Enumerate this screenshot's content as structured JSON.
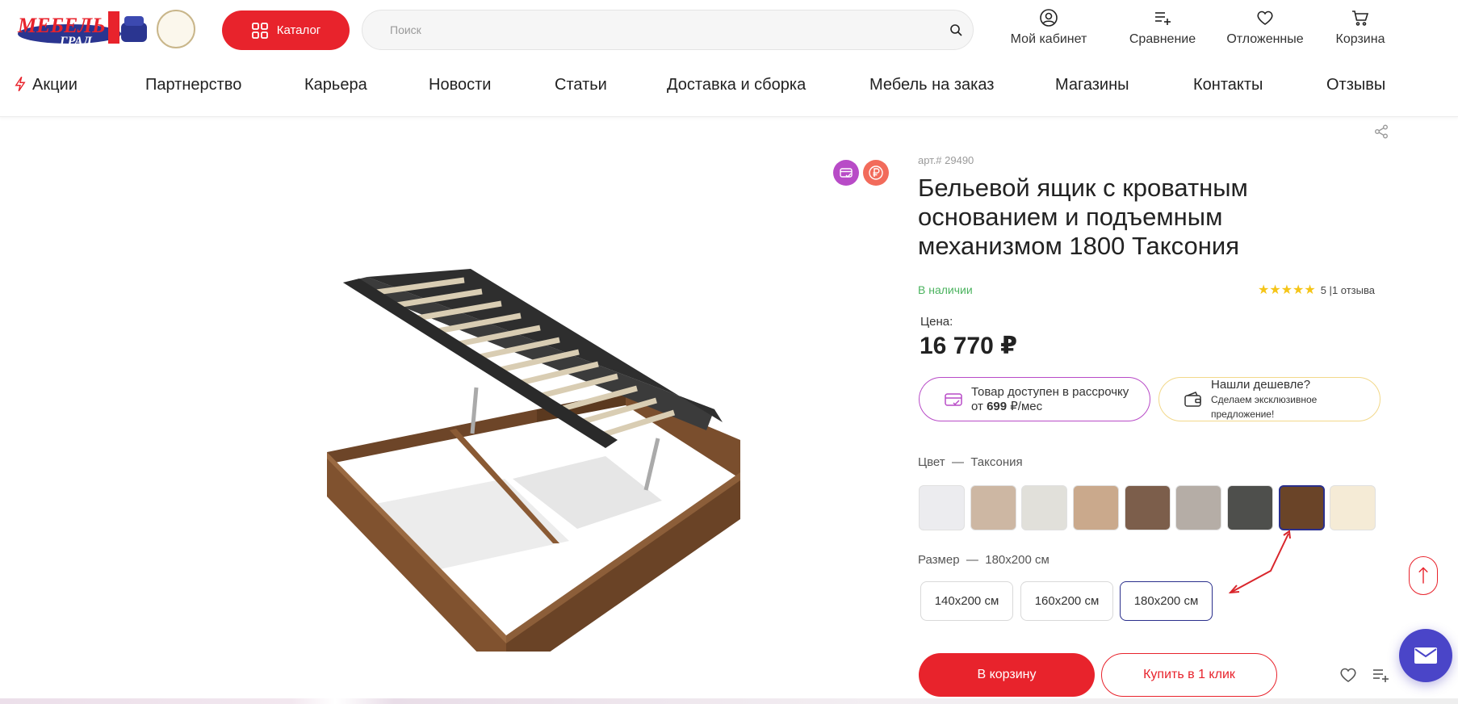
{
  "header": {
    "logo_text": "МЕБЕЛЬ ГРАД",
    "catalog_label": "Каталог",
    "search_placeholder": "Поиск",
    "account_label": "Мой кабинет",
    "compare_label": "Сравнение",
    "favorites_label": "Отложенные",
    "cart_label": "Корзина"
  },
  "nav": {
    "items": [
      "Акции",
      "Партнерство",
      "Карьера",
      "Новости",
      "Статьи",
      "Доставка и сборка",
      "Мебель на заказ",
      "Магазины",
      "Контакты",
      "Отзывы"
    ]
  },
  "product": {
    "sku": "арт.# 29490",
    "title": "Бельевой ящик с кроватным основанием и подъемным механизмом 1800 Таксония",
    "stock": "В наличии",
    "rating_stars": "★★★★★",
    "rating_text": "5 |1 отзыва",
    "price_label": "Цена:",
    "price": "16 770 ₽",
    "installment_line1": "Товар доступен в рассрочку",
    "installment_prefix": "от ",
    "installment_amount": "699",
    "installment_suffix": " ₽/мес",
    "cheaper_title": "Нашли дешевле?",
    "cheaper_subtitle": "Сделаем эксклюзивное предложение!",
    "color_label": "Цвет",
    "color_sep": "—",
    "color_value": "Таксония",
    "swatches": [
      {
        "color": "#ececef"
      },
      {
        "color": "#cdb7a3"
      },
      {
        "color": "#e1e0da"
      },
      {
        "color": "#caa98c"
      },
      {
        "color": "#7c5e4b"
      },
      {
        "color": "#b5ada6"
      },
      {
        "color": "#4e4f4c"
      },
      {
        "color": "#6a4428",
        "selected": true
      },
      {
        "color": "#f5ebd6"
      }
    ],
    "size_label": "Размер",
    "size_sep": "—",
    "size_value": "180х200 см",
    "sizes": [
      "140х200 см",
      "160х200 см",
      "180х200 см"
    ],
    "selected_size_index": 2,
    "cart_button": "В корзину",
    "oneclick_button": "Купить в 1 клик"
  },
  "colors": {
    "brand_red": "#e8232c",
    "selection_blue": "#2a2f8c",
    "stock_green": "#4bb35f",
    "installment_purple": "#b84bc7",
    "fab_blue": "#4a45c8"
  }
}
